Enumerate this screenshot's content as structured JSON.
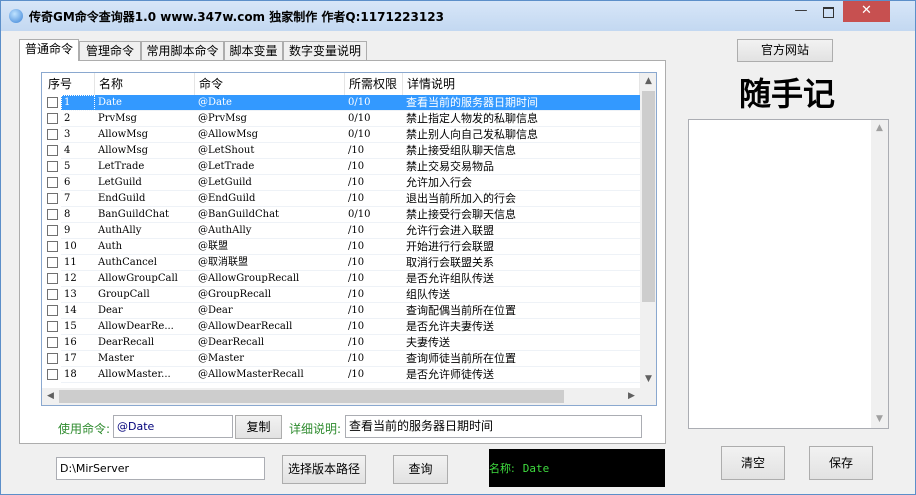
{
  "window": {
    "title": "传奇GM命令查询器1.0 www.347w.com 独家制作 作者Q:1171223123",
    "minimize_glyph": "—",
    "close_glyph": "✕"
  },
  "tabs": [
    "普通命令",
    "管理命令",
    "常用脚本命令",
    "脚本变量",
    "数字变量说明"
  ],
  "table": {
    "headers": [
      "序号",
      "名称",
      "命令",
      "所需权限",
      "详情说明"
    ],
    "rows": [
      [
        "1",
        "Date",
        "@Date",
        "0/10",
        "查看当前的服务器日期时间"
      ],
      [
        "2",
        "PrvMsg",
        "@PrvMsg",
        "0/10",
        "禁止指定人物发的私聊信息"
      ],
      [
        "3",
        "AllowMsg",
        "@AllowMsg",
        "0/10",
        "禁止别人向自己发私聊信息"
      ],
      [
        "4",
        "AllowMsg",
        "@LetShout",
        "/10",
        "禁止接受组队聊天信息"
      ],
      [
        "5",
        "LetTrade",
        "@LetTrade",
        "/10",
        "禁止交易交易物品"
      ],
      [
        "6",
        "LetGuild",
        "@LetGuild",
        "/10",
        "允许加入行会"
      ],
      [
        "7",
        "EndGuild",
        "@EndGuild",
        "/10",
        "退出当前所加入的行会"
      ],
      [
        "8",
        "BanGuildChat",
        "@BanGuildChat",
        "0/10",
        "禁止接受行会聊天信息"
      ],
      [
        "9",
        "AuthAlly",
        "@AuthAlly",
        "/10",
        "允许行会进入联盟"
      ],
      [
        "10",
        "Auth",
        "@联盟",
        "/10",
        "开始进行行会联盟"
      ],
      [
        "11",
        "AuthCancel",
        "@取消联盟",
        "/10",
        "取消行会联盟关系"
      ],
      [
        "12",
        "AllowGroupCall",
        "@AllowGroupRecall",
        "/10",
        "是否允许组队传送"
      ],
      [
        "13",
        "GroupCall",
        "@GroupRecall",
        "/10",
        "组队传送"
      ],
      [
        "14",
        "Dear",
        "@Dear",
        "/10",
        "查询配偶当前所在位置"
      ],
      [
        "15",
        "AllowDearRe...",
        "@AllowDearRecall",
        "/10",
        "是否允许夫妻传送"
      ],
      [
        "16",
        "DearRecall",
        "@DearRecall",
        "/10",
        "夫妻传送"
      ],
      [
        "17",
        "Master",
        "@Master",
        "/10",
        "查询师徒当前所在位置"
      ],
      [
        "18",
        "AllowMaster...",
        "@AllowMasterRecall",
        "/10",
        "是否允许师徒传送"
      ]
    ],
    "selected_row": 0
  },
  "command_bar": {
    "use_label": "使用命令:",
    "use_value": "@Date",
    "copy_button": "复制",
    "detail_label": "详细说明:",
    "detail_value": "查看当前的服务器日期时间"
  },
  "bottom_bar": {
    "path_value": "D:\\MirServer",
    "choose_path_button": "选择版本路径",
    "query_button": "查询",
    "name_label": "名称:",
    "name_value": "Date"
  },
  "notes_panel": {
    "website_button": "官方网站",
    "title": "随手记",
    "clear_button": "清空",
    "save_button": "保存"
  }
}
